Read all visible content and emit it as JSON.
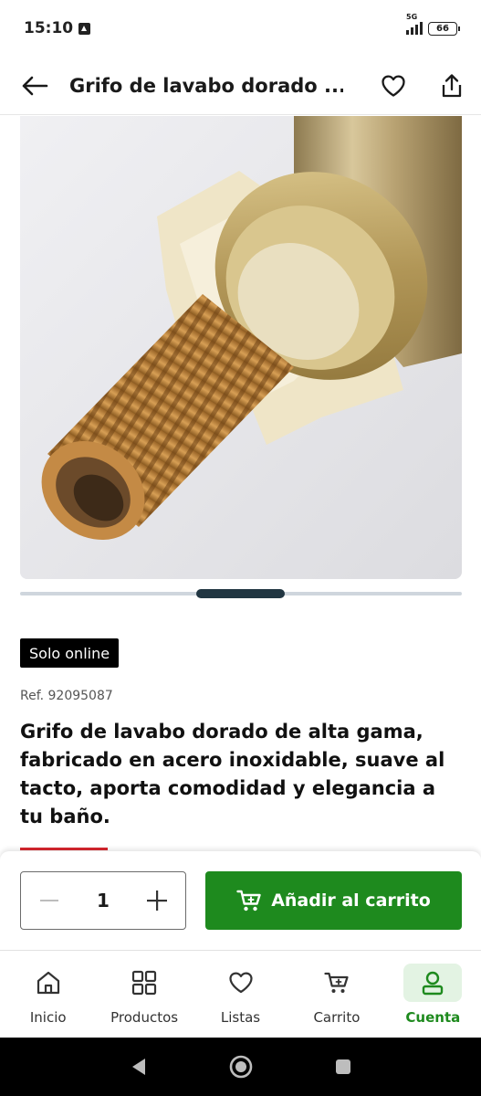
{
  "status_bar": {
    "time": "15:10",
    "network": "5G",
    "battery": "66"
  },
  "header": {
    "title": "Grifo de lavabo dorado ..."
  },
  "product": {
    "badge": "Solo online",
    "ref": "Ref. 92095087",
    "title": "Grifo de lavabo dorado de alta gama, fabricado en acero inoxidable, suave al tacto, aporta comodidad y elegancia a tu baño."
  },
  "gallery": {
    "active_index": 1,
    "count": 5
  },
  "buy_bar": {
    "quantity": "1",
    "add_to_cart_label": "Añadir al carrito"
  },
  "bottom_nav": {
    "items": [
      {
        "label": "Inicio",
        "icon": "home-icon"
      },
      {
        "label": "Productos",
        "icon": "grid-icon"
      },
      {
        "label": "Listas",
        "icon": "heart-icon"
      },
      {
        "label": "Carrito",
        "icon": "cart-icon"
      },
      {
        "label": "Cuenta",
        "icon": "user-icon",
        "active": true
      }
    ]
  },
  "colors": {
    "primary_green": "#1e8a1e",
    "accent_red": "#d8262e",
    "badge_bg": "#000000"
  }
}
